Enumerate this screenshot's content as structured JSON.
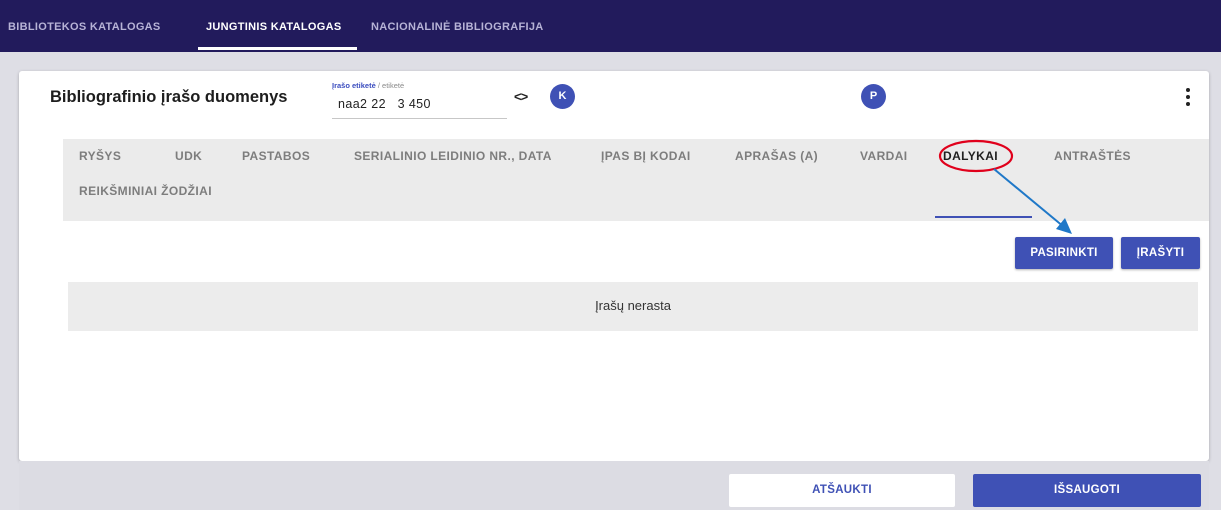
{
  "topnav": {
    "items": [
      {
        "label": "BIBLIOTEKOS KATALOGAS",
        "active": false
      },
      {
        "label": "JUNGTINIS KATALOGAS",
        "active": true
      },
      {
        "label": "NACIONALINĖ BIBLIOGRAFIJA",
        "active": false
      }
    ]
  },
  "record": {
    "title": "Bibliografinio įrašo duomenys",
    "label_field": {
      "label_main": "Įrašo etiketė",
      "label_sep": " / ",
      "label_alt": "etiketė",
      "value": "naa2 22   3 450"
    },
    "code_icon": "<>",
    "avatar_k": "K",
    "avatar_p": "P"
  },
  "tabs": [
    {
      "label": "RYŠYS"
    },
    {
      "label": "UDK"
    },
    {
      "label": "PASTABOS"
    },
    {
      "label": "SERIALINIO LEIDINIO NR., DATA"
    },
    {
      "label": "ĮPAS BĮ KODAI"
    },
    {
      "label": "APRAŠAS (A)"
    },
    {
      "label": "VARDAI"
    },
    {
      "label": "DALYKAI"
    },
    {
      "label": "ANTRAŠTĖS"
    },
    {
      "label": "REIKŠMINIAI ŽODŽIAI"
    }
  ],
  "actions": {
    "select_label": "PASIRINKTI",
    "write_label": "ĮRAŠYTI"
  },
  "empty_state": "Įrašų nerasta",
  "footer": {
    "cancel_label": "ATŠAUKTI",
    "save_label": "IŠSAUGOTI"
  },
  "colors": {
    "nav_bg": "#221b5c",
    "accent": "#3f51b5",
    "annotation_circle": "#e0001b",
    "annotation_arrow": "#1f78c8"
  }
}
